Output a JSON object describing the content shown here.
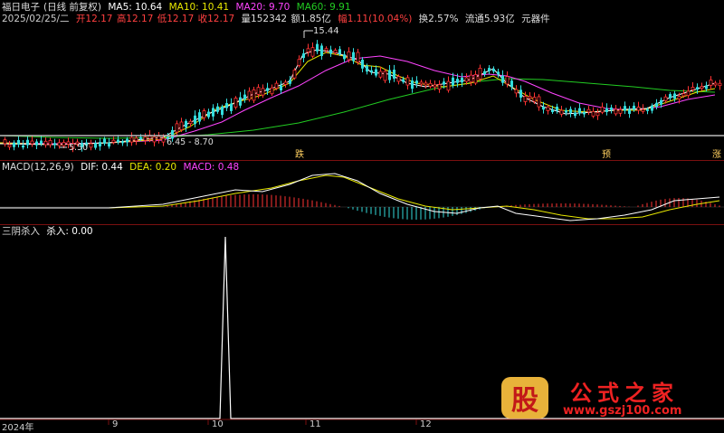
{
  "header": {
    "title_prefix": "福日电子",
    "title_mode": "(日线 前复权)",
    "ma5": "MA5: 10.64",
    "ma10": "MA10: 10.41",
    "ma20": "MA20: 9.70",
    "ma60": "MA60: 9.91",
    "date": "2025/02/25/二",
    "open": "开12.17",
    "high": "高12.17",
    "low": "低12.17",
    "close": "收12.17",
    "volume": "量152342",
    "amount": "额1.85亿",
    "change": "幅1.11(10.04%)",
    "turnover": "换2.57%",
    "float_cap": "流通5.93亿",
    "chip": "元器件"
  },
  "price_chart": {
    "high_label": "15.44",
    "low_label_left": "5.50",
    "range_label": "6.45 - 8.70",
    "tag_left": "跌",
    "tag_mid": "预",
    "tag_right": "涨"
  },
  "macd": {
    "title": "MACD(12,26,9)",
    "dif": "DIF: 0.44",
    "dea": "DEA: 0.20",
    "macd": "MACD: 0.48"
  },
  "indicator": {
    "title": "三阴杀入",
    "value": "杀入: 0.00"
  },
  "xaxis": {
    "labels": [
      "2024年",
      "9",
      "10",
      "11",
      "12"
    ]
  },
  "logo": {
    "gu": "股",
    "title": "公式之家",
    "url": "www.gszj100.com"
  },
  "colors": {
    "ma5": "#ffffff",
    "ma10": "#e8e800",
    "ma20": "#ff44ff",
    "ma60": "#22cc22",
    "up": "#ff3333",
    "down": "#33dddd"
  }
}
